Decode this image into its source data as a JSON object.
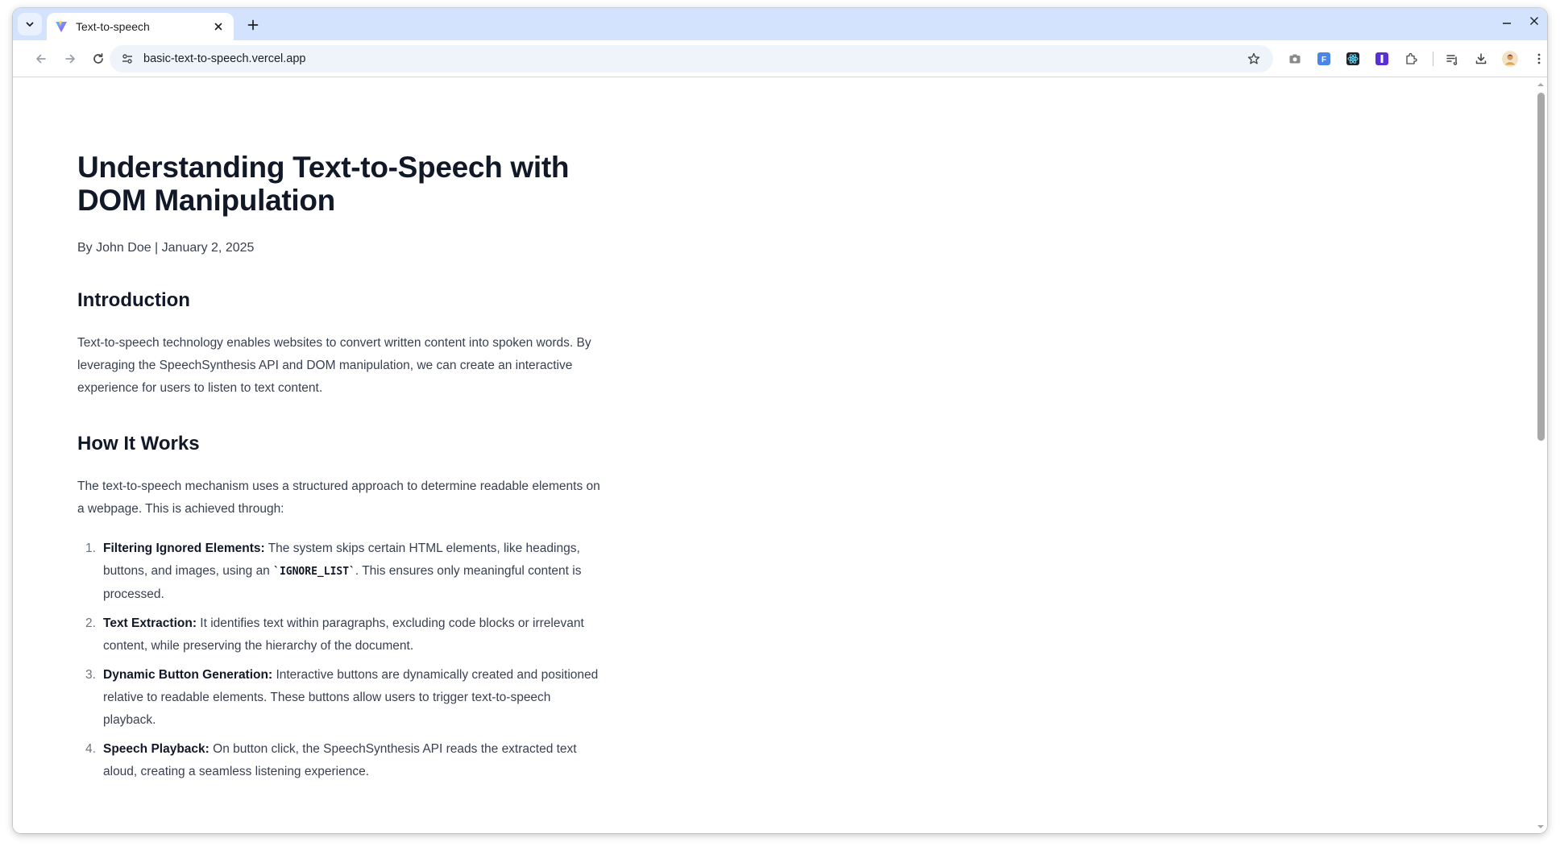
{
  "browser": {
    "tab_title": "Text-to-speech",
    "url": "basic-text-to-speech.vercel.app",
    "extensions": [
      "camera-icon",
      "translate-icon",
      "react-devtools-icon",
      "password-manager-icon",
      "extensions-puzzle-icon",
      "reading-list-icon",
      "downloads-icon",
      "profile-avatar",
      "menu-icon"
    ]
  },
  "article": {
    "title": "Understanding Text-to-Speech with DOM Manipulation",
    "meta": "By John Doe | January 2, 2025",
    "intro_heading": "Introduction",
    "intro_text": "Text-to-speech technology enables websites to convert written content into spoken words. By leveraging the SpeechSynthesis API and DOM manipulation, we can create an interactive experience for users to listen to text content.",
    "how_heading": "How It Works",
    "how_text": "The text-to-speech mechanism uses a structured approach to determine readable elements on a webpage. This is achieved through:",
    "steps": [
      {
        "num": "1.",
        "title": "Filtering Ignored Elements:",
        "text_before": " The system skips certain HTML elements, like headings, buttons, and images, using an ",
        "code": "`IGNORE_LIST`",
        "text_after": ". This ensures only meaningful content is processed."
      },
      {
        "num": "2.",
        "title": "Text Extraction:",
        "text": " It identifies text within paragraphs, excluding code blocks or irrelevant content, while preserving the hierarchy of the document."
      },
      {
        "num": "3.",
        "title": "Dynamic Button Generation:",
        "text": " Interactive buttons are dynamically created and positioned relative to readable elements. These buttons allow users to trigger text-to-speech playback."
      },
      {
        "num": "4.",
        "title": "Speech Playback:",
        "text": " On button click, the SpeechSynthesis API reads the extracted text aloud, creating a seamless listening experience."
      }
    ]
  }
}
